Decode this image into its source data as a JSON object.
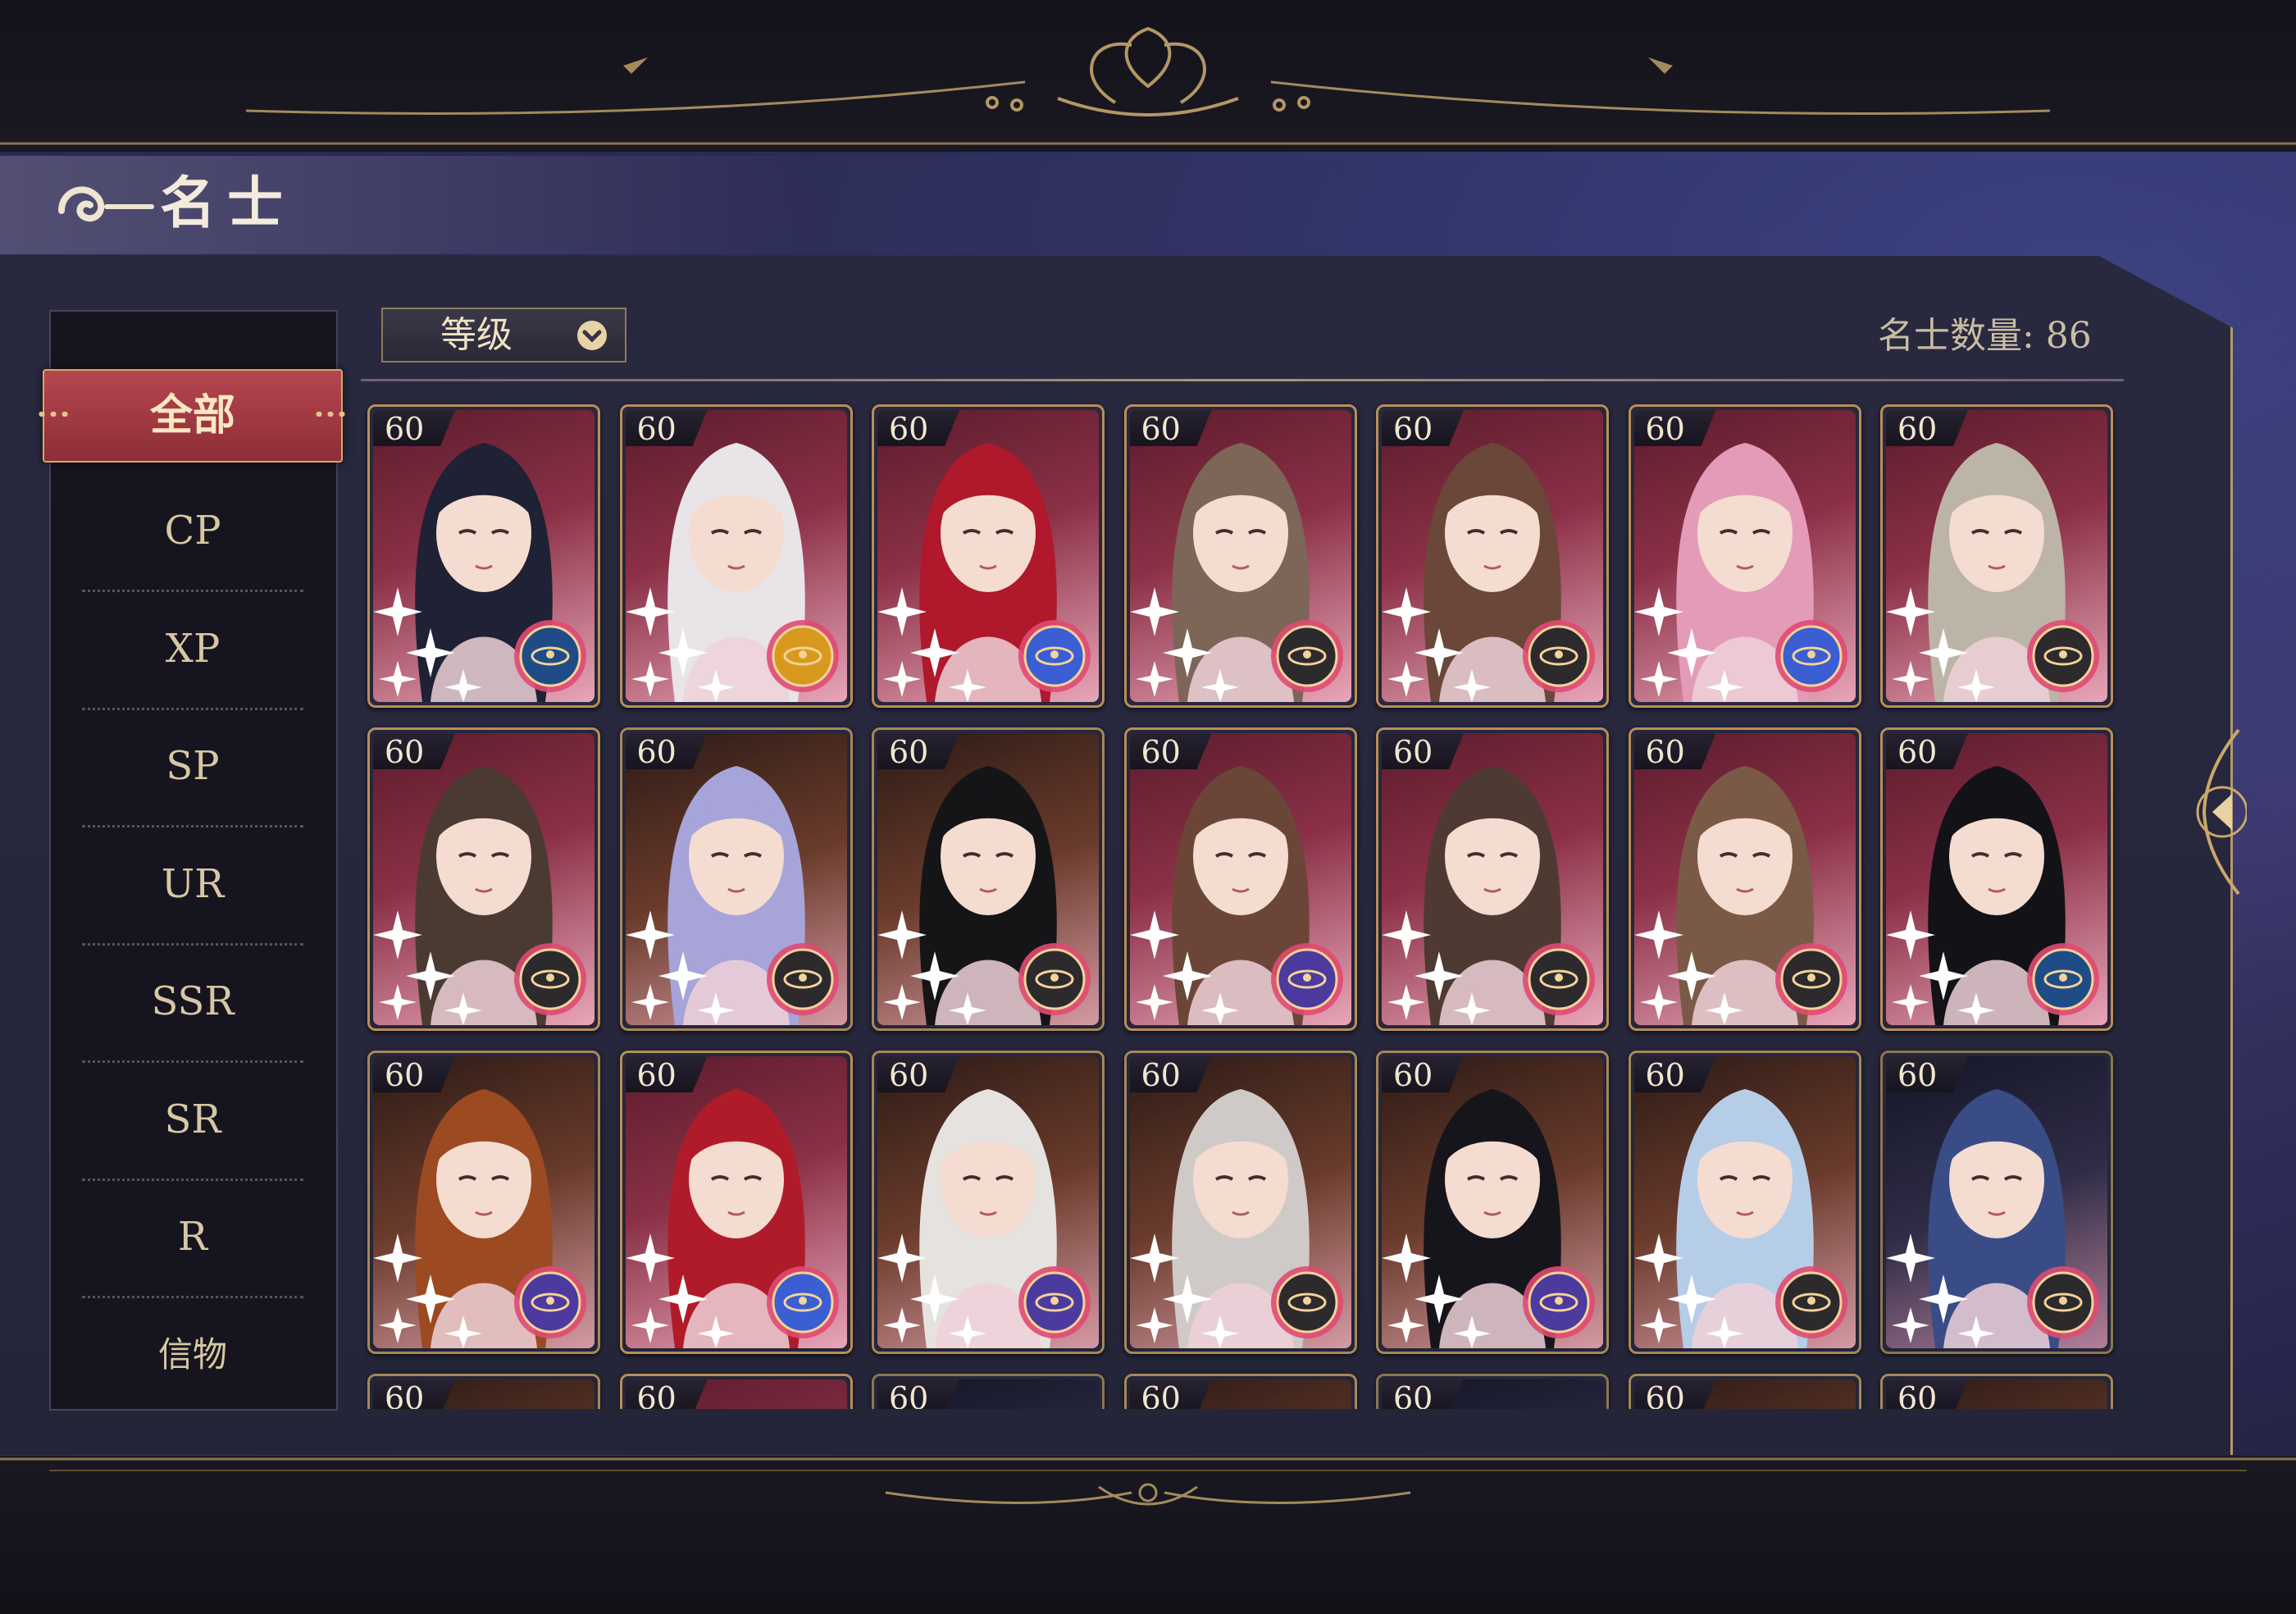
{
  "header": {
    "title": "名士"
  },
  "sidebar": {
    "active": "全部",
    "items": [
      {
        "label": "CP"
      },
      {
        "label": "XP"
      },
      {
        "label": "SP"
      },
      {
        "label": "UR"
      },
      {
        "label": "SSR"
      },
      {
        "label": "SR"
      },
      {
        "label": "R"
      },
      {
        "label": "信物"
      }
    ]
  },
  "toolbar": {
    "sort_label": "等级",
    "count_label": "名士数量: 86"
  },
  "colors": {
    "gold": "#c9a86a",
    "active_red": "#a63a43",
    "panel": "#25253a",
    "pink_card": "#e8a6b8"
  },
  "cards": [
    {
      "level": "60",
      "theme": "rose",
      "hair": "#1f2134",
      "badge": "star-map"
    },
    {
      "level": "60",
      "theme": "rose",
      "hair": "#e8e4e8",
      "badge": "gold-planet"
    },
    {
      "level": "60",
      "theme": "rose",
      "hair": "#b0182c",
      "badge": "blue-planet"
    },
    {
      "level": "60",
      "theme": "rose",
      "hair": "#7d6558",
      "badge": "crescent"
    },
    {
      "level": "60",
      "theme": "rose",
      "hair": "#6a4738",
      "badge": "crescent"
    },
    {
      "level": "60",
      "theme": "rose",
      "hair": "#e49bb8",
      "badge": "blue-planet"
    },
    {
      "level": "60",
      "theme": "rose",
      "hair": "#bdb4a8",
      "badge": "crescent"
    },
    {
      "level": "60",
      "theme": "rose",
      "hair": "#4a3a32",
      "badge": "crescent"
    },
    {
      "level": "60",
      "theme": "bronze",
      "hair": "#a6a4d8",
      "badge": "crescent"
    },
    {
      "level": "60",
      "theme": "bronze",
      "hair": "#151518",
      "badge": "crescent"
    },
    {
      "level": "60",
      "theme": "rose",
      "hair": "#6b4638",
      "badge": "violet-planet"
    },
    {
      "level": "60",
      "theme": "rose",
      "hair": "#4e3a33",
      "badge": "crescent"
    },
    {
      "level": "60",
      "theme": "rose",
      "hair": "#7a5a46",
      "badge": "crescent"
    },
    {
      "level": "60",
      "theme": "rose",
      "hair": "#121217",
      "badge": "star-map"
    },
    {
      "level": "60",
      "theme": "bronze",
      "hair": "#9c4a22",
      "badge": "violet-planet"
    },
    {
      "level": "60",
      "theme": "rose",
      "hair": "#b01b2a",
      "badge": "blue-planet"
    },
    {
      "level": "60",
      "theme": "bronze",
      "hair": "#e6e2e0",
      "badge": "violet-planet"
    },
    {
      "level": "60",
      "theme": "bronze",
      "hair": "#cfcac8",
      "badge": "crescent"
    },
    {
      "level": "60",
      "theme": "bronze",
      "hair": "#16151b",
      "badge": "violet-planet"
    },
    {
      "level": "60",
      "theme": "bronze",
      "hair": "#b6cde8",
      "badge": "crescent"
    },
    {
      "level": "60",
      "theme": "night",
      "hair": "#3a4c86",
      "badge": "crescent"
    },
    {
      "level": "60",
      "theme": "bronze",
      "hair": "#c2a88e",
      "badge": "crescent"
    },
    {
      "level": "60",
      "theme": "rose",
      "hair": "#d8c6c4",
      "badge": "crescent"
    },
    {
      "level": "60",
      "theme": "night",
      "hair": "#3b304a",
      "badge": "crescent"
    },
    {
      "level": "60",
      "theme": "bronze",
      "hair": "#c8b49a",
      "badge": "crescent"
    },
    {
      "level": "60",
      "theme": "night",
      "hair": "#2a2630",
      "badge": "crescent"
    },
    {
      "level": "60",
      "theme": "bronze",
      "hair": "#a98a6c",
      "badge": "crescent"
    },
    {
      "level": "60",
      "theme": "bronze",
      "hair": "#b2987c",
      "badge": "crescent"
    }
  ]
}
